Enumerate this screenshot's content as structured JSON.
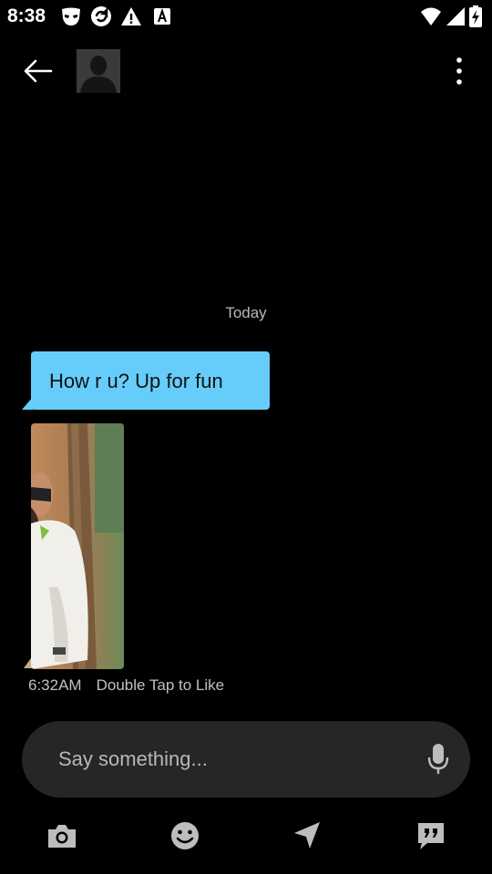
{
  "status_bar": {
    "time": "8:38",
    "icons": [
      "grindr-mask-icon",
      "sync-icon",
      "warning-icon",
      "font-app-icon",
      "wifi-icon",
      "cell-signal-icon",
      "battery-charging-icon"
    ]
  },
  "header": {
    "back_icon": "arrow-left-icon",
    "avatar": "profile-placeholder",
    "menu_icon": "more-vertical-icon"
  },
  "conversation": {
    "date_separator": "Today",
    "messages": [
      {
        "type": "text",
        "text": "How r u? Up for fun"
      },
      {
        "type": "photo"
      }
    ],
    "meta": {
      "time": "6:32AM",
      "hint": "Double Tap to Like"
    }
  },
  "composer": {
    "placeholder": "Say something...",
    "value": "",
    "mic_icon": "microphone-icon"
  },
  "toolbar": {
    "items": [
      "camera-icon",
      "emoji-icon",
      "location-send-icon",
      "saved-phrases-icon"
    ]
  },
  "colors": {
    "background": "#000000",
    "bubble": "#66cdfb",
    "composer_bg": "#262626",
    "muted_text": "#b8b8b8"
  }
}
